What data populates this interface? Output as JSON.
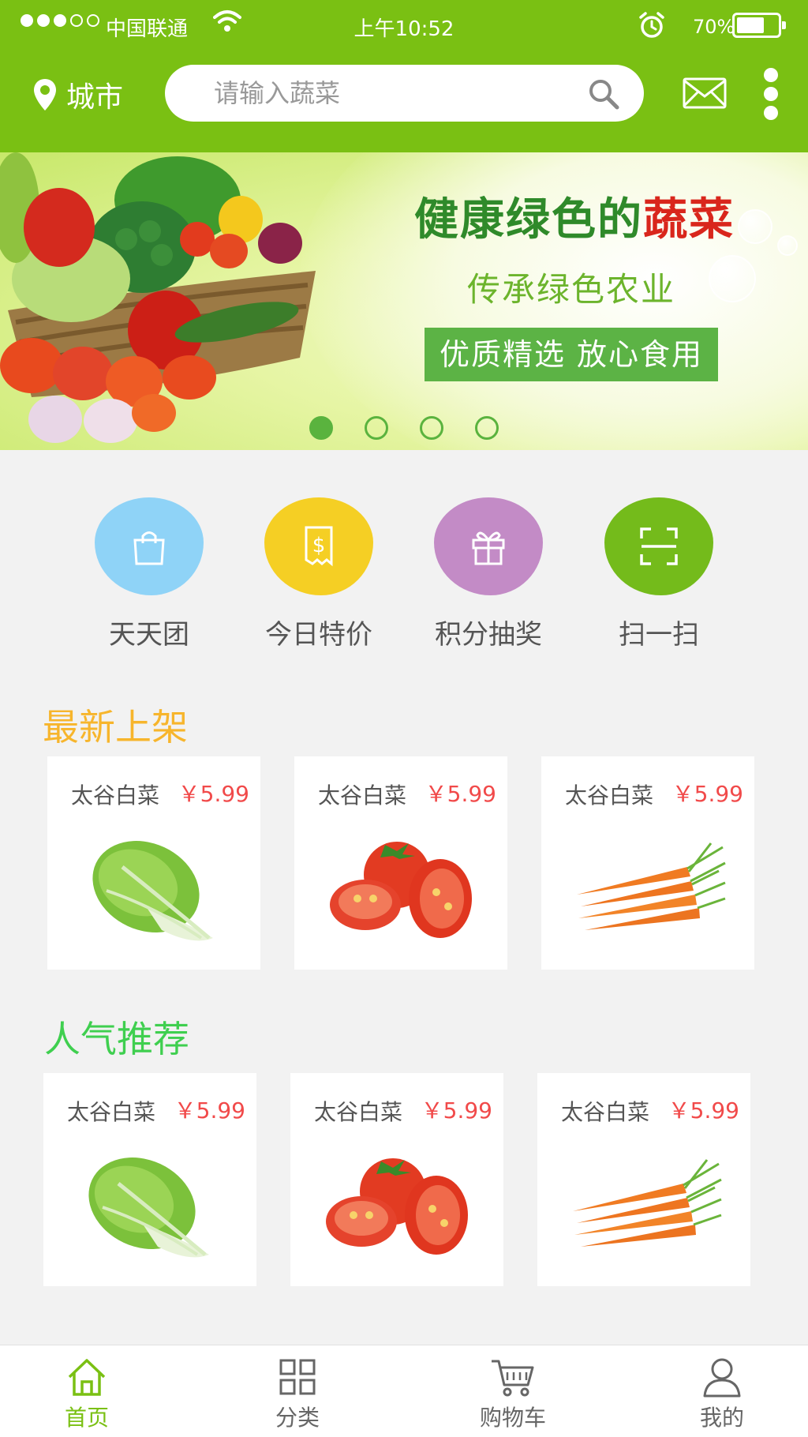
{
  "status_bar": {
    "carrier": "中国联通",
    "time": "上午10:52",
    "battery_percent": "70%",
    "battery_level": 0.7
  },
  "top_bar": {
    "city_label": "城市",
    "search_placeholder": "请输入蔬菜"
  },
  "banner": {
    "title_green": "健康绿色的",
    "title_red": "蔬菜",
    "subtitle": "传承绿色农业",
    "tag": "优质精选 放心食用",
    "slide_count": 4,
    "active_slide": 1
  },
  "quick_menu": [
    {
      "label": "天天团",
      "icon": "shopping-bag-icon",
      "color": "#8fd3f7"
    },
    {
      "label": "今日特价",
      "icon": "receipt-dollar-icon",
      "color": "#f5cf24"
    },
    {
      "label": "积分抽奖",
      "icon": "gift-icon",
      "color": "#c38bc6"
    },
    {
      "label": "扫一扫",
      "icon": "scan-icon",
      "color": "#74bb1b"
    }
  ],
  "sections": {
    "new_arrivals": {
      "title": "最新上架",
      "color": "#f7b52c",
      "items": [
        {
          "name": "太谷白菜",
          "price": "￥5.99",
          "image": "napa-cabbage"
        },
        {
          "name": "太谷白菜",
          "price": "￥5.99",
          "image": "tomatoes"
        },
        {
          "name": "太谷白菜",
          "price": "￥5.99",
          "image": "carrots"
        }
      ]
    },
    "popular": {
      "title": "人气推荐",
      "color": "#3fcf4f",
      "items": [
        {
          "name": "太谷白菜",
          "price": "￥5.99",
          "image": "napa-cabbage"
        },
        {
          "name": "太谷白菜",
          "price": "￥5.99",
          "image": "tomatoes"
        },
        {
          "name": "太谷白菜",
          "price": "￥5.99",
          "image": "carrots"
        }
      ]
    }
  },
  "tab_bar": [
    {
      "label": "首页",
      "icon": "home-icon",
      "active": true
    },
    {
      "label": "分类",
      "icon": "grid-icon",
      "active": false
    },
    {
      "label": "购物车",
      "icon": "cart-icon",
      "active": false
    },
    {
      "label": "我的",
      "icon": "user-icon",
      "active": false
    }
  ],
  "colors": {
    "brand_green": "#7ac013",
    "price_red": "#f14a4a"
  }
}
